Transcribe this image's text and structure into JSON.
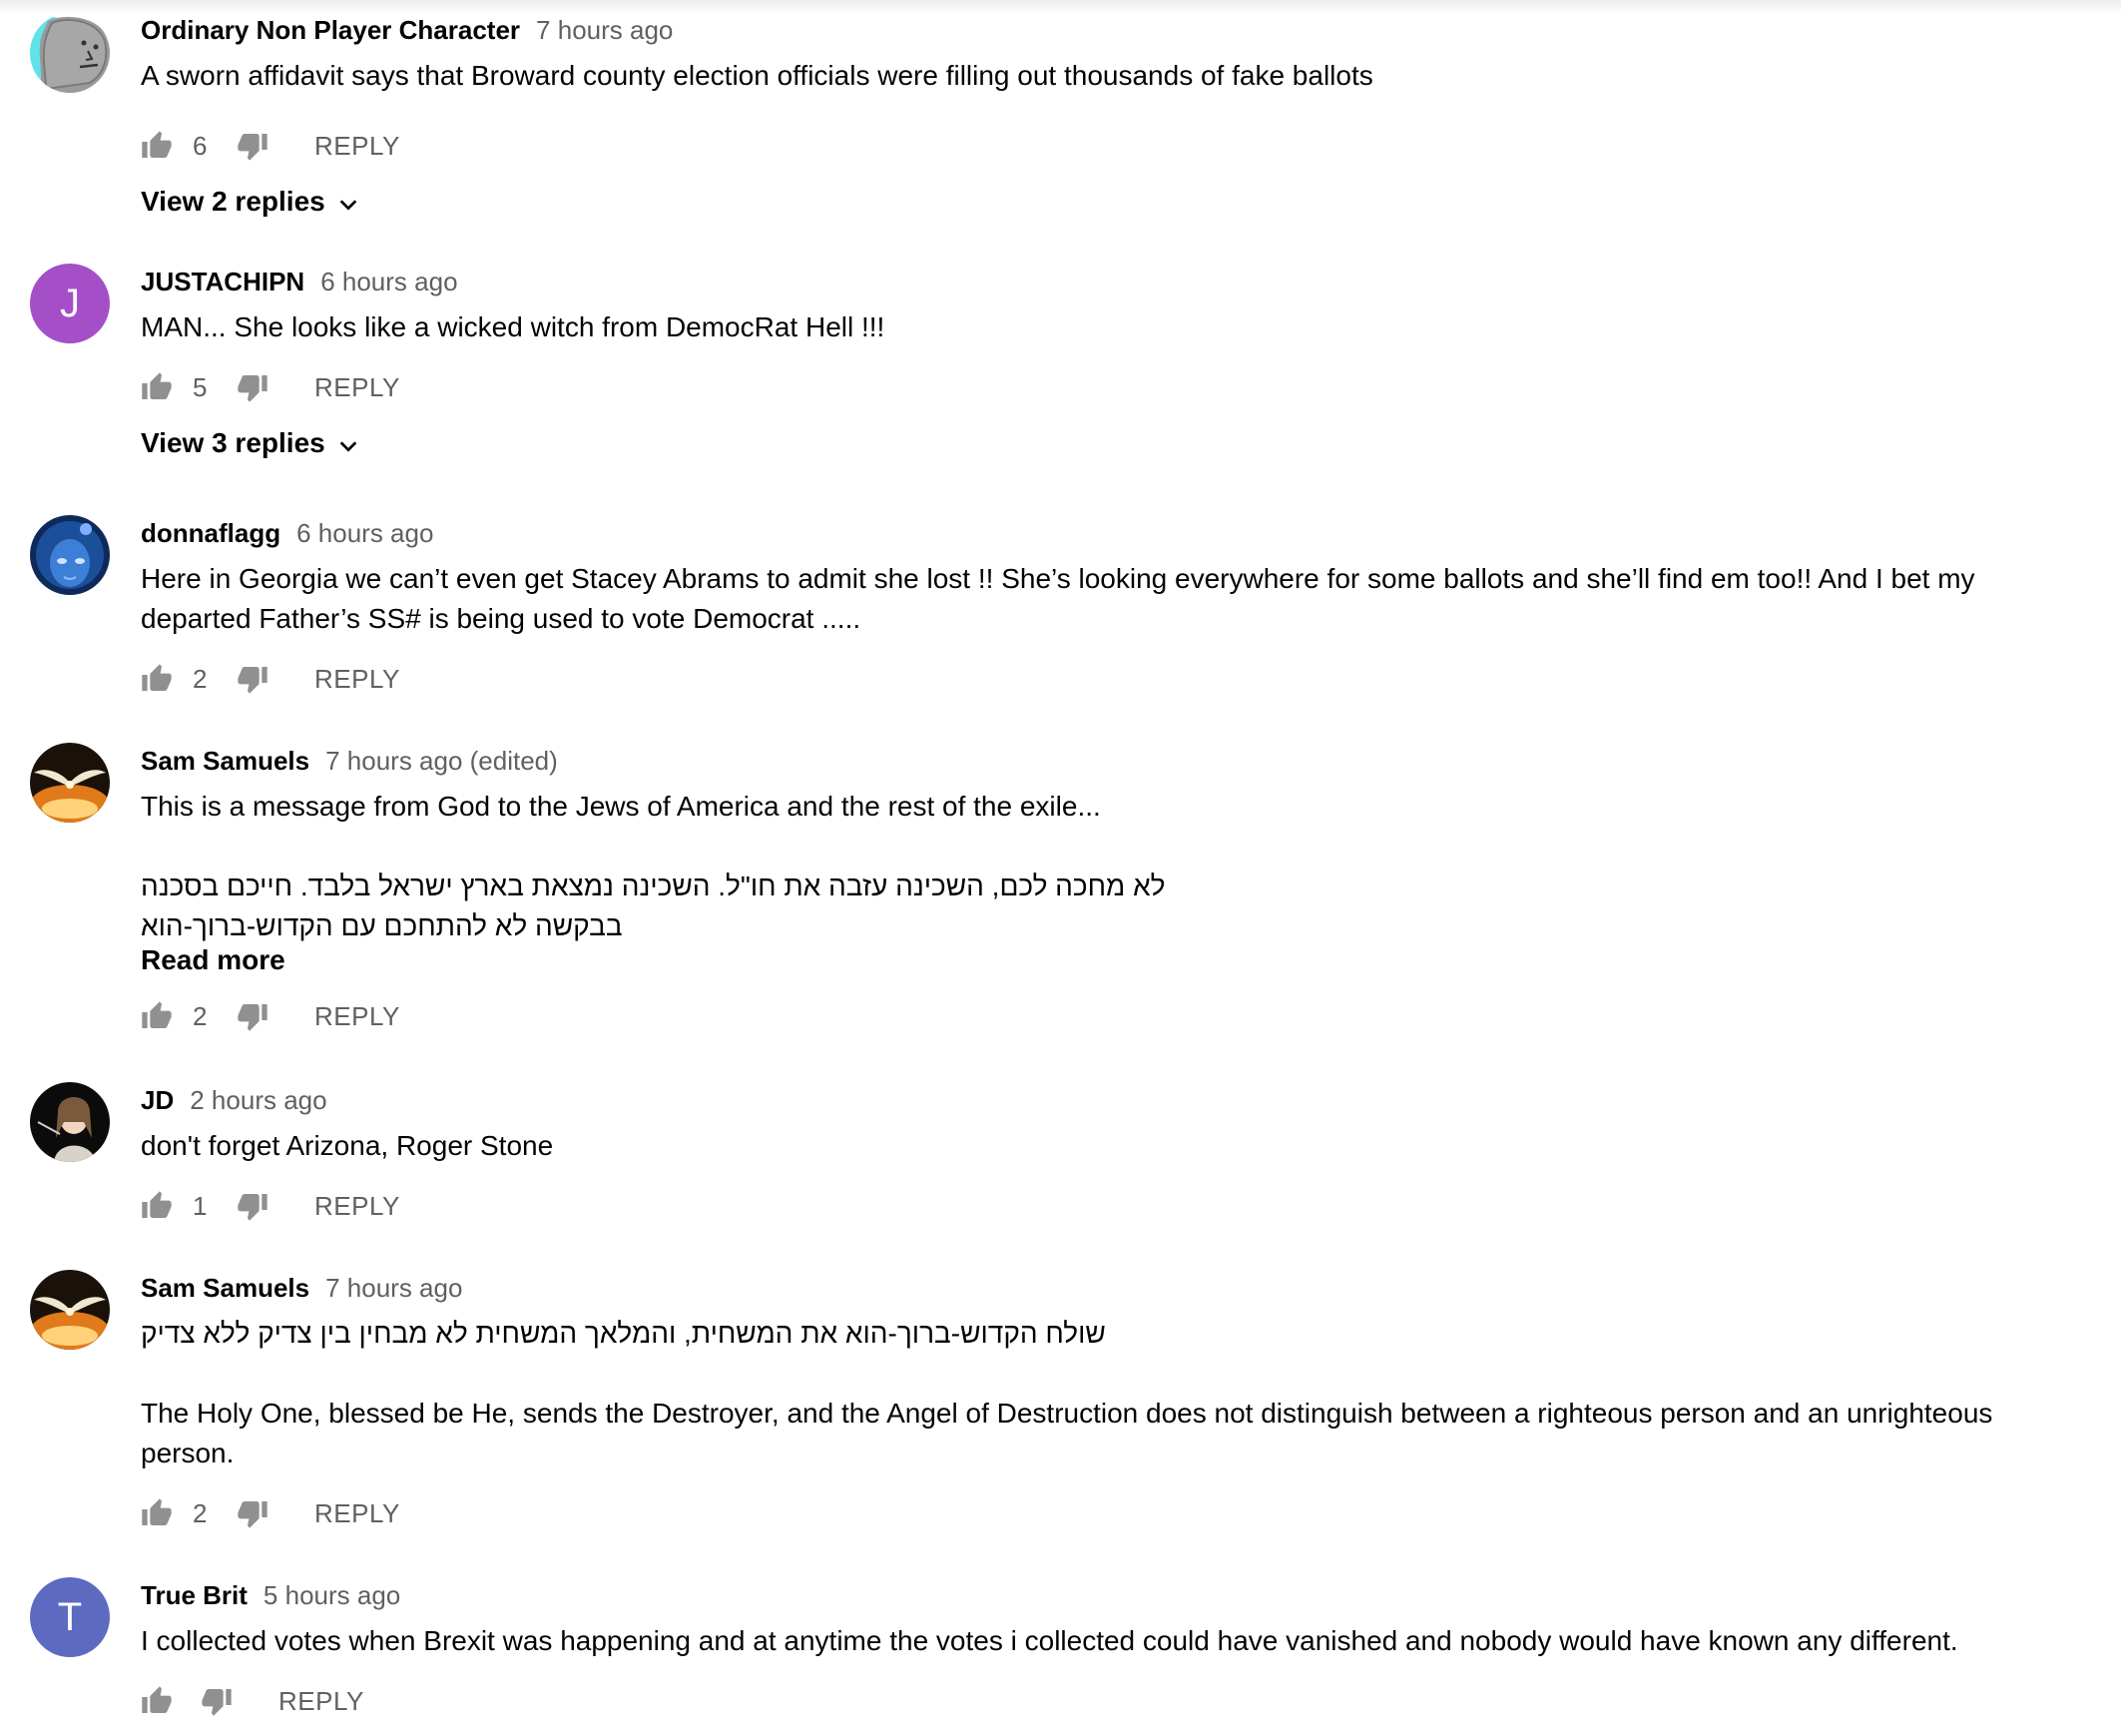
{
  "comments": [
    {
      "author": "Ordinary Non Player Character",
      "time": "7 hours ago",
      "text": "A sworn affidavit says that Broward county election officials were filling out thousands of fake ballots",
      "likes": "6",
      "reply_label": "REPLY",
      "view_replies": "View 2 replies"
    },
    {
      "author": "JUSTACHIPN",
      "time": "6 hours ago",
      "avatar_letter": "J",
      "avatar_color": "#a44fc7",
      "text": "MAN... She looks like a wicked witch from DemocRat Hell !!!",
      "likes": "5",
      "reply_label": "REPLY",
      "view_replies": "View 3 replies"
    },
    {
      "author": "donnaflagg",
      "time": "6 hours ago",
      "text_line1": "Here in Georgia we can’t even get Stacey Abrams to admit she lost !!  She’s looking everywhere for some ballots and she’ll find em too!! And I bet my",
      "text_line2": "departed Father’s SS# is being used to vote Democrat .....",
      "likes": "2",
      "reply_label": "REPLY"
    },
    {
      "author": "Sam Samuels",
      "time": "7 hours ago (edited)",
      "text_line1": "This is a message from God to the Jews of America and the rest of the exile...",
      "hebrew_line1": "לא מחכה לכם, השכינה עזבה את חו\"ל. השכינה נמצאת בארץ ישראל בלבד. חייכם בסכנה",
      "hebrew_line2": "בבקשה לא להתחכם עם הקדוש-ברוך-הוא",
      "read_more": "Read more",
      "likes": "2",
      "reply_label": "REPLY"
    },
    {
      "author": "JD",
      "time": "2 hours ago",
      "text": "don't forget Arizona, Roger Stone",
      "likes": "1",
      "reply_label": "REPLY"
    },
    {
      "author": "Sam Samuels",
      "time": "7 hours ago",
      "hebrew_line1": "שולח הקדוש-ברוך-הוא את המשחית, והמלאך המשחית לא מבחין בין צדיק ללא צדיק",
      "text_line1": "The Holy One, blessed be He, sends the Destroyer, and the Angel of Destruction does not distinguish between a righteous person and an unrighteous",
      "text_line2": "person.",
      "likes": "2",
      "reply_label": "REPLY"
    },
    {
      "author": "True Brit",
      "time": "5 hours ago",
      "avatar_letter": "T",
      "avatar_color": "#5c6bc0",
      "text": "I collected votes when Brexit was happening and at anytime the votes i collected could have vanished and nobody would have known any different.",
      "reply_label": "REPLY"
    }
  ],
  "icons": {
    "like": "thumb-up-icon",
    "dislike": "thumb-down-icon",
    "expand": "chevron-down-icon"
  },
  "colors": {
    "text": "#030303",
    "secondary": "#606060",
    "icon": "#909090"
  }
}
